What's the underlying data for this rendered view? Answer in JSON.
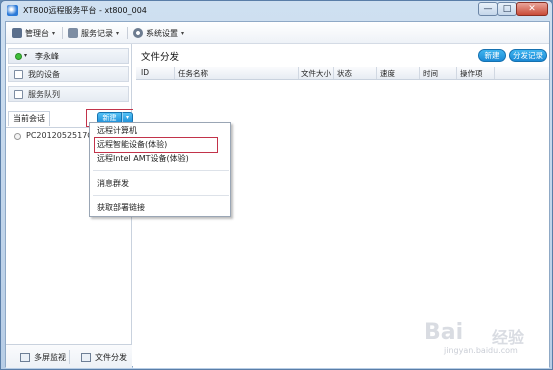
{
  "window": {
    "title": "XT800远程服务平台 - xt800_004",
    "minimize_glyph": "—",
    "maximize_glyph": "□",
    "close_glyph": "✕"
  },
  "menubar": {
    "items": [
      {
        "label": "管理台",
        "icon": "computer-icon"
      },
      {
        "label": "服务记录",
        "icon": "record-icon"
      },
      {
        "label": "系统设置",
        "icon": "gear-icon"
      }
    ],
    "chevron": "▾"
  },
  "sidebar": {
    "user_name": "李永峰",
    "status_chevron": "▾",
    "status_color": "#3fbf3a",
    "nav": [
      {
        "label": "我的设备",
        "icon": "device-icon"
      },
      {
        "label": "服务队列",
        "icon": "queue-icon"
      }
    ],
    "tab_label": "当前会话",
    "new_button": "新建",
    "new_dropdown_glyph": "▾",
    "sessions": [
      {
        "label": "PC2012052517QVD"
      }
    ],
    "bottom_buttons": [
      {
        "label": "多屏监视",
        "icon": "monitor-icon"
      },
      {
        "label": "文件分发",
        "icon": "file-icon"
      }
    ]
  },
  "main": {
    "title": "文件分发",
    "new_button": "新建",
    "records_button": "分发记录",
    "columns": [
      "ID",
      "任务名称",
      "文件大小",
      "状态",
      "速度",
      "时间",
      "操作项"
    ]
  },
  "dropdown": {
    "items": [
      "远程计算机",
      "远程智能设备(体验)",
      "远程Intel AMT设备(体验)",
      "消息群发",
      "获取部署链接"
    ],
    "highlighted_index": 1
  },
  "colors": {
    "accent": "#1e8fd8",
    "highlight_border": "#c2334a",
    "title_bar": "#b7cde6"
  },
  "watermark": {
    "brand": "Bai",
    "brand_suffix": "经验",
    "url": "jingyan.baidu.com"
  }
}
